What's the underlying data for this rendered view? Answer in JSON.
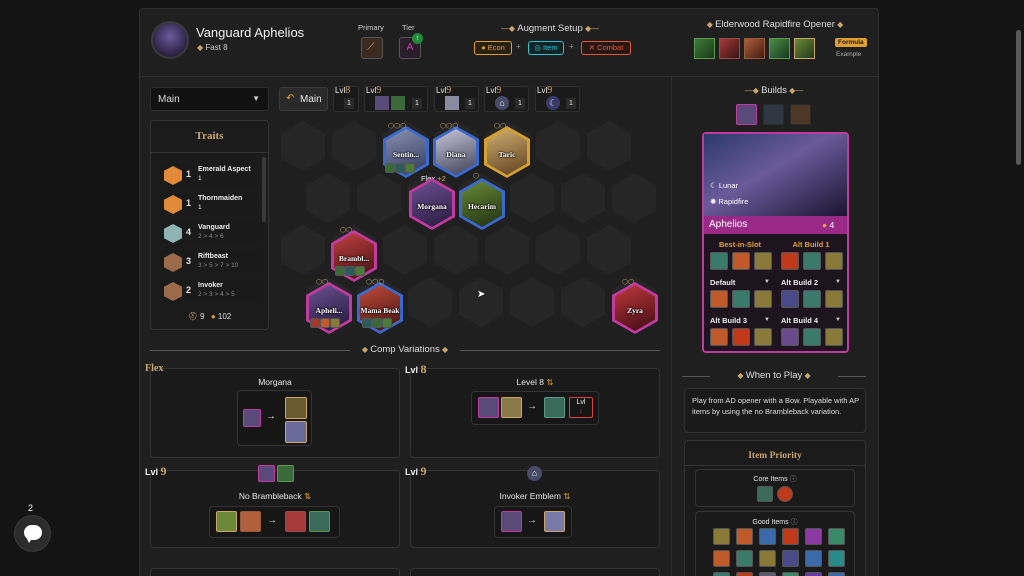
{
  "header": {
    "champion_name": "Vanguard Aphelios",
    "speed_label": "Fast 8",
    "primary_label": "Primary",
    "tier_label": "Tier",
    "tier_value": "A",
    "augment_title": "Augment Setup",
    "augments": [
      "Econ",
      "Item",
      "Combat"
    ],
    "opener_title": "Elderwood Rapidfire Opener",
    "formula_label": "Formula",
    "example_label": "Example"
  },
  "board": {
    "dropdown_value": "Main",
    "main_button": "Main",
    "levels": [
      {
        "label": "Lvl",
        "num": "8",
        "count": "1"
      },
      {
        "label": "Lvl",
        "num": "9",
        "count": "1"
      },
      {
        "label": "Lvl",
        "num": "9",
        "count": "1"
      },
      {
        "label": "Lvl",
        "num": "9",
        "count": "1"
      },
      {
        "label": "Lvl",
        "num": "9",
        "count": "1"
      }
    ],
    "champions": [
      "Sentin...",
      "Diana",
      "Taric",
      "Morgana",
      "Hecarim",
      "Brambl...",
      "Apheli...",
      "Mama Beak",
      "Zyra"
    ],
    "flex_label": "Flex",
    "flex_plus": "+2"
  },
  "traits": {
    "title": "Traits",
    "items": [
      {
        "count": "1",
        "name": "Emerald Aspect",
        "steps": "1",
        "color": "#e08a3a"
      },
      {
        "count": "1",
        "name": "Thornmaiden",
        "steps": "1",
        "color": "#e08a3a"
      },
      {
        "count": "4",
        "name": "Vanguard",
        "steps": "2 > 4 > 6",
        "color": "#8fb4b4"
      },
      {
        "count": "3",
        "name": "Riftbeast",
        "steps": "3 > 5 > 7 > 10",
        "color": "#9a6a4a"
      },
      {
        "count": "2",
        "name": "Invoker",
        "steps": "2 > 3 > 4 > 5",
        "color": "#9a6a4a"
      }
    ],
    "footer_units": "9",
    "footer_gold": "102"
  },
  "variations": {
    "title": "Comp Variations",
    "cards": [
      {
        "tag": "Flex",
        "lvl": "",
        "name": "Morgana"
      },
      {
        "tag": "Lvl",
        "lvl": "8",
        "name": "Level 8"
      },
      {
        "tag": "Lvl",
        "lvl": "9",
        "name": "No Brambleback"
      },
      {
        "tag": "Lvl",
        "lvl": "9",
        "name": "Invoker Emblem"
      }
    ],
    "lvl_box": "Lvl"
  },
  "builds": {
    "title": "Builds",
    "carry_traits": [
      "Lunar",
      "Rapidfire"
    ],
    "carry_name": "Aphelios",
    "carry_cost": "4",
    "columns": [
      {
        "label": "Best-in-Slot"
      },
      {
        "label": "Alt Build 1"
      },
      {
        "label": "Default"
      },
      {
        "label": "Alt Build 2"
      },
      {
        "label": "Alt Build 3"
      },
      {
        "label": "Alt Build 4"
      }
    ]
  },
  "when_to_play": {
    "title": "When to Play",
    "text": "Play from AD opener with a Bow. Playable with AP items by using the no Brambleback variation."
  },
  "item_priority": {
    "title": "Item Priority",
    "core_label": "Core Items",
    "good_label": "Good Items"
  },
  "chat": {
    "badge": "2"
  },
  "colors": {
    "accent_gold": "#c9a56a",
    "tier_purple": "#d23caa",
    "econ": "#e0a030",
    "item": "#2ec4d4",
    "combat": "#e05a3a"
  }
}
